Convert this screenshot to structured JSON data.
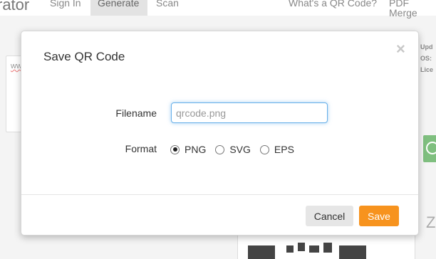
{
  "nav": {
    "brand": "rator",
    "items": [
      {
        "label": "Sign In"
      },
      {
        "label": "Generate"
      },
      {
        "label": "Scan"
      },
      {
        "label": "What's a QR Code?"
      },
      {
        "label": "PDF Merge"
      }
    ]
  },
  "background": {
    "left_card_text": "ww",
    "right_labels": [
      "Upd",
      "OS:",
      "Lice"
    ],
    "partial_letter": "Z"
  },
  "modal": {
    "title": "Save QR Code",
    "close_glyph": "×",
    "filename_label": "Filename",
    "filename_placeholder": "qrcode.png",
    "filename_value": "",
    "format_label": "Format",
    "formats": [
      {
        "label": "PNG",
        "checked": true
      },
      {
        "label": "SVG",
        "checked": false
      },
      {
        "label": "EPS",
        "checked": false
      }
    ],
    "cancel_label": "Cancel",
    "save_label": "Save"
  },
  "colors": {
    "accent": "#f7931e",
    "input_focus": "#66afe9"
  }
}
